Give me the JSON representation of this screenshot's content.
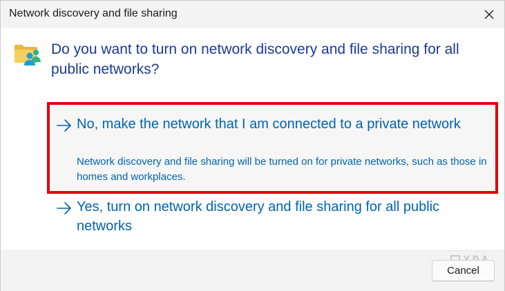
{
  "window": {
    "title": "Network discovery and file sharing"
  },
  "dialog": {
    "instruction": "Do you want to turn on network discovery and file sharing for all public networks?",
    "options": [
      {
        "label": "No, make the network that I am connected to a private network",
        "note": "Network discovery and file sharing will be turned on for private networks, such as those in homes and workplaces."
      },
      {
        "label": "Yes, turn on network discovery and file sharing for all public networks"
      }
    ]
  },
  "footer": {
    "cancel_label": "Cancel",
    "watermark": "XDA"
  },
  "colors": {
    "instruction": "#1b3a93",
    "link": "#0063b1",
    "highlight": "#e2000f",
    "titlebar": "#f3f3f3",
    "footer": "#f3f3f3"
  },
  "icons": {
    "app": "network-folder-users-icon",
    "close": "close-icon",
    "option_arrow": "arrow-right-icon",
    "watermark": "xda-logo-icon"
  }
}
